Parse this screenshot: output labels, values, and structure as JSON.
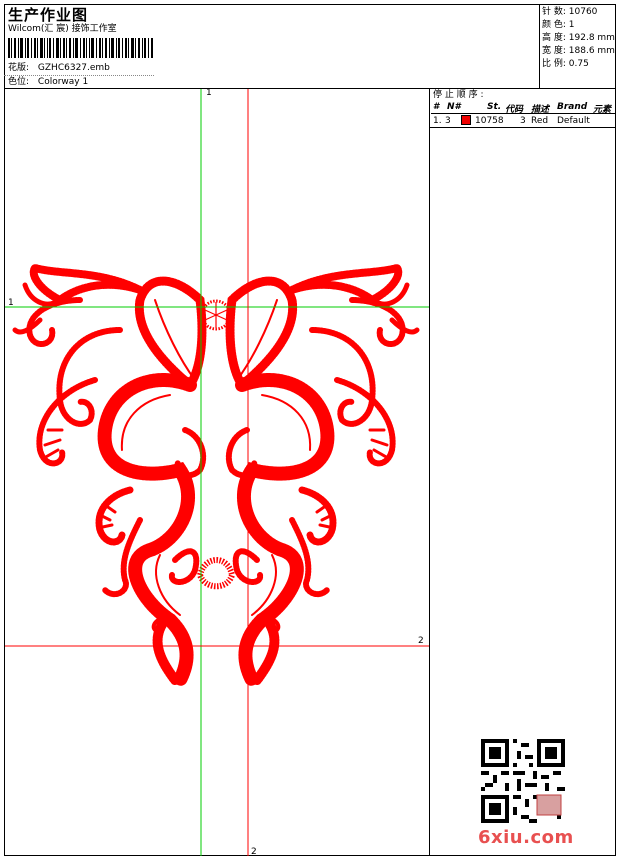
{
  "header": {
    "title": "生产作业图",
    "studio": "Wilcom(汇 宸) 接饰工作室",
    "design_label": "花版:",
    "design_file": "GZHC6327.emb",
    "color_label": "色位:",
    "colorway": "Colorway 1"
  },
  "stats": [
    {
      "label": "针 数:",
      "value": "10760"
    },
    {
      "label": "颜 色:",
      "value": "1"
    },
    {
      "label": "高 度:",
      "value": "192.8 mm"
    },
    {
      "label": "宽 度:",
      "value": "188.6 mm"
    },
    {
      "label": "比 例:",
      "value": "0.75"
    }
  ],
  "thread_panel": {
    "heading": "停 止 顺 序 :",
    "columns": [
      "#",
      "N#",
      "St.",
      "代码",
      "描述",
      "Brand",
      "元素"
    ],
    "rows": [
      {
        "index": "1.",
        "n": "3",
        "color": "#e00000",
        "stitches": "10758",
        "code": "3",
        "description": "Red",
        "brand": "Default",
        "element": ""
      }
    ]
  },
  "axes": {
    "green_top": "1",
    "green_left": "1",
    "red_right": "2",
    "red_bottom": "2"
  },
  "watermark": "6xiu.com",
  "colors": {
    "embroidery": "#ff0000",
    "green_axis": "#00cc00",
    "red_axis": "#ff0000"
  }
}
